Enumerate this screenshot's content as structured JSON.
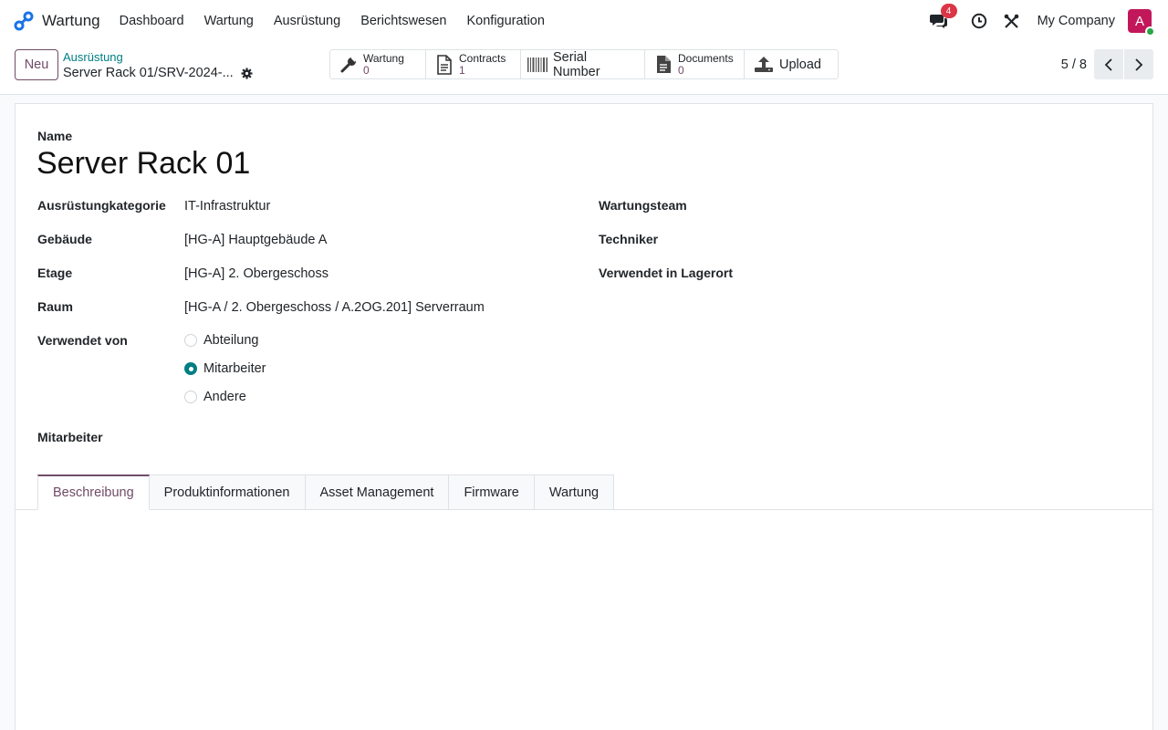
{
  "navbar": {
    "app_name": "Wartung",
    "menu": [
      "Dashboard",
      "Wartung",
      "Ausrüstung",
      "Berichtswesen",
      "Konfiguration"
    ],
    "messages_badge": "4",
    "company": "My Company",
    "avatar_letter": "A"
  },
  "control": {
    "new_label": "Neu",
    "breadcrumb_parent": "Ausrüstung",
    "breadcrumb_current": "Server Rack 01/SRV-2024-...",
    "smart_buttons": [
      {
        "label": "Wartung",
        "value": "0",
        "icon": "wrench-icon"
      },
      {
        "label": "Contracts",
        "value": "1",
        "icon": "document-icon"
      },
      {
        "label": "Serial Number",
        "icon": "barcode-icon"
      },
      {
        "label": "Documents",
        "value": "0",
        "icon": "file-icon"
      },
      {
        "label": "Upload",
        "icon": "upload-icon"
      }
    ],
    "pager": "5 / 8"
  },
  "form": {
    "name_label": "Name",
    "name_value": "Server Rack 01",
    "fields_left": [
      {
        "label": "Ausrüstungkategorie",
        "value": "IT-Infrastruktur"
      },
      {
        "label": "Gebäude",
        "value": "[HG-A] Hauptgebäude A"
      },
      {
        "label": "Etage",
        "value": "[HG-A] 2. Obergeschoss"
      },
      {
        "label": "Raum",
        "value": "[HG-A / 2. Obergeschoss / A.2OG.201] Serverraum"
      }
    ],
    "fields_right": [
      {
        "label": "Wartungsteam"
      },
      {
        "label": "Techniker"
      },
      {
        "label": "Verwendet in Lagerort"
      }
    ],
    "used_by_label": "Verwendet von",
    "used_by_options": [
      "Abteilung",
      "Mitarbeiter",
      "Andere"
    ],
    "used_by_selected": "Mitarbeiter",
    "employee_label": "Mitarbeiter"
  },
  "tabs": [
    "Beschreibung",
    "Produktinformationen",
    "Asset Management",
    "Firmware",
    "Wartung"
  ],
  "colors": {
    "primary": "#714b67",
    "accent": "#017e84",
    "badge": "#dc3545"
  }
}
